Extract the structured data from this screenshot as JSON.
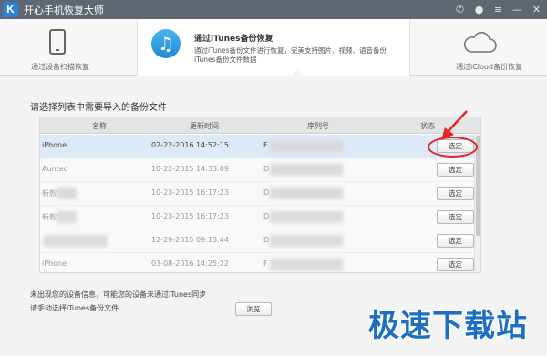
{
  "app": {
    "title": "开心手机恢复大师",
    "logo": "K"
  },
  "window_controls": [
    {
      "icon": "wechat-icon",
      "glyph": "✆"
    },
    {
      "icon": "chat-icon",
      "glyph": "●"
    },
    {
      "icon": "menu-icon",
      "glyph": "≡"
    },
    {
      "icon": "minimize-icon",
      "glyph": "—"
    },
    {
      "icon": "close-icon",
      "glyph": "✕"
    }
  ],
  "modes": {
    "device": {
      "label": "通过设备扫描恢复",
      "icon": "phone-icon"
    },
    "itunes": {
      "title": "通过iTunes备份恢复",
      "description": "通过iTunes备份文件进行恢复，完美支持图片、视频、语音备份iTunes备份文件数据",
      "icon": "music-note-icon",
      "glyph": "♫"
    },
    "icloud": {
      "label": "通过iCloud备份恢复",
      "icon": "cloud-icon"
    }
  },
  "panel": {
    "heading": "请选择列表中需要导入的备份文件",
    "columns": {
      "name": "名称",
      "time": "更新时间",
      "serial": "序列号",
      "status": "状态"
    },
    "rows": [
      {
        "name": "iPhone",
        "time": "02-22-2016 14:52:15",
        "serial": "F",
        "button": "选定",
        "selected": true
      },
      {
        "name": "Auntec",
        "time": "10-22-2015 14:33:09",
        "serial": "D",
        "button": "选定",
        "selected": false
      },
      {
        "name": "新款",
        "time": "10-23-2015 16:17:23",
        "serial": "D",
        "button": "选定",
        "selected": false
      },
      {
        "name": "新款",
        "time": "10-23-2015 16:17:23",
        "serial": "D",
        "button": "选定",
        "selected": false
      },
      {
        "name": "",
        "time": "12-29-2015 09:13:44",
        "serial": "D",
        "button": "选定",
        "selected": false
      },
      {
        "name": "iPhone",
        "time": "03-08-2016 14:25:22",
        "serial": "F",
        "button": "选定",
        "selected": false
      }
    ],
    "footer_note": "未出现您的设备信息，可能您的设备未通过iTunes同步",
    "footer_label": "请手动选择iTunes备份文件",
    "browse_label": "浏览"
  },
  "annotation_color": "#e02525",
  "watermark": "极速下载站"
}
